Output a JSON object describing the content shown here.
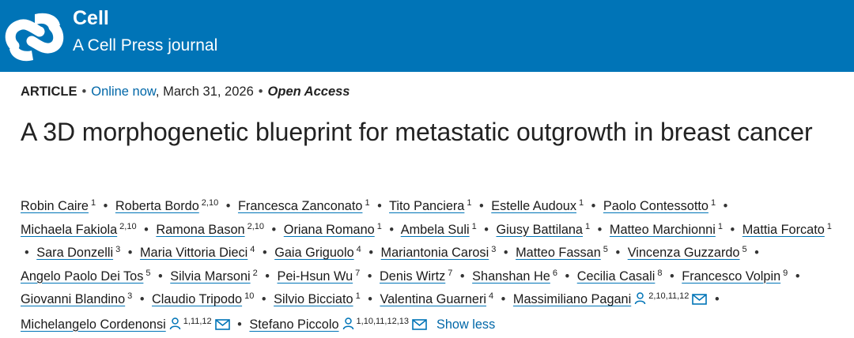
{
  "brand": {
    "name": "Cell",
    "tagline": "A Cell Press journal",
    "color": "#0074b7"
  },
  "meta": {
    "type": "ARTICLE",
    "online": "Online now",
    "date": ", March 31, 2026",
    "access": "Open Access"
  },
  "title": "A 3D morphogenetic blueprint for metastatic outgrowth in breast cancer",
  "authors": [
    {
      "name": "Robin Caire",
      "aff": "1"
    },
    {
      "name": "Roberta Bordo",
      "aff": "2,10"
    },
    {
      "name": "Francesca Zanconato",
      "aff": "1"
    },
    {
      "name": "Tito Panciera",
      "aff": "1"
    },
    {
      "name": "Estelle Audoux",
      "aff": "1"
    },
    {
      "name": "Paolo Contessotto",
      "aff": "1"
    },
    {
      "name": "Michaela Fakiola",
      "aff": "2,10"
    },
    {
      "name": "Ramona Bason",
      "aff": "2,10"
    },
    {
      "name": "Oriana Romano",
      "aff": "1"
    },
    {
      "name": "Ambela Suli",
      "aff": "1"
    },
    {
      "name": "Giusy Battilana",
      "aff": "1"
    },
    {
      "name": "Matteo Marchionni",
      "aff": "1"
    },
    {
      "name": "Mattia Forcato",
      "aff": "1"
    },
    {
      "name": "Sara Donzelli",
      "aff": "3"
    },
    {
      "name": "Maria Vittoria Dieci",
      "aff": "4"
    },
    {
      "name": "Gaia Griguolo",
      "aff": "4"
    },
    {
      "name": "Mariantonia Carosi",
      "aff": "3"
    },
    {
      "name": "Matteo Fassan",
      "aff": "5"
    },
    {
      "name": "Vincenza Guzzardo",
      "aff": "5"
    },
    {
      "name": "Angelo Paolo Dei Tos",
      "aff": "5"
    },
    {
      "name": "Silvia Marsoni",
      "aff": "2"
    },
    {
      "name": "Pei-Hsun Wu",
      "aff": "7"
    },
    {
      "name": "Denis Wirtz",
      "aff": "7"
    },
    {
      "name": "Shanshan He",
      "aff": "6"
    },
    {
      "name": "Cecilia Casali",
      "aff": "8"
    },
    {
      "name": "Francesco Volpin",
      "aff": "9"
    },
    {
      "name": "Giovanni Blandino",
      "aff": "3"
    },
    {
      "name": "Claudio Tripodo",
      "aff": "10"
    },
    {
      "name": "Silvio Bicciato",
      "aff": "1"
    },
    {
      "name": "Valentina Guarneri",
      "aff": "4"
    },
    {
      "name": "Massimiliano Pagani",
      "aff": "2,10,11,12",
      "corresponding": true
    },
    {
      "name": "Michelangelo Cordenonsi",
      "aff": "1,11,12",
      "corresponding": true
    },
    {
      "name": "Stefano Piccolo",
      "aff": "1,10,11,12,13",
      "corresponding": true
    }
  ],
  "show_less": "Show less",
  "icons": {
    "person": "person-icon",
    "mail": "mail-icon"
  }
}
